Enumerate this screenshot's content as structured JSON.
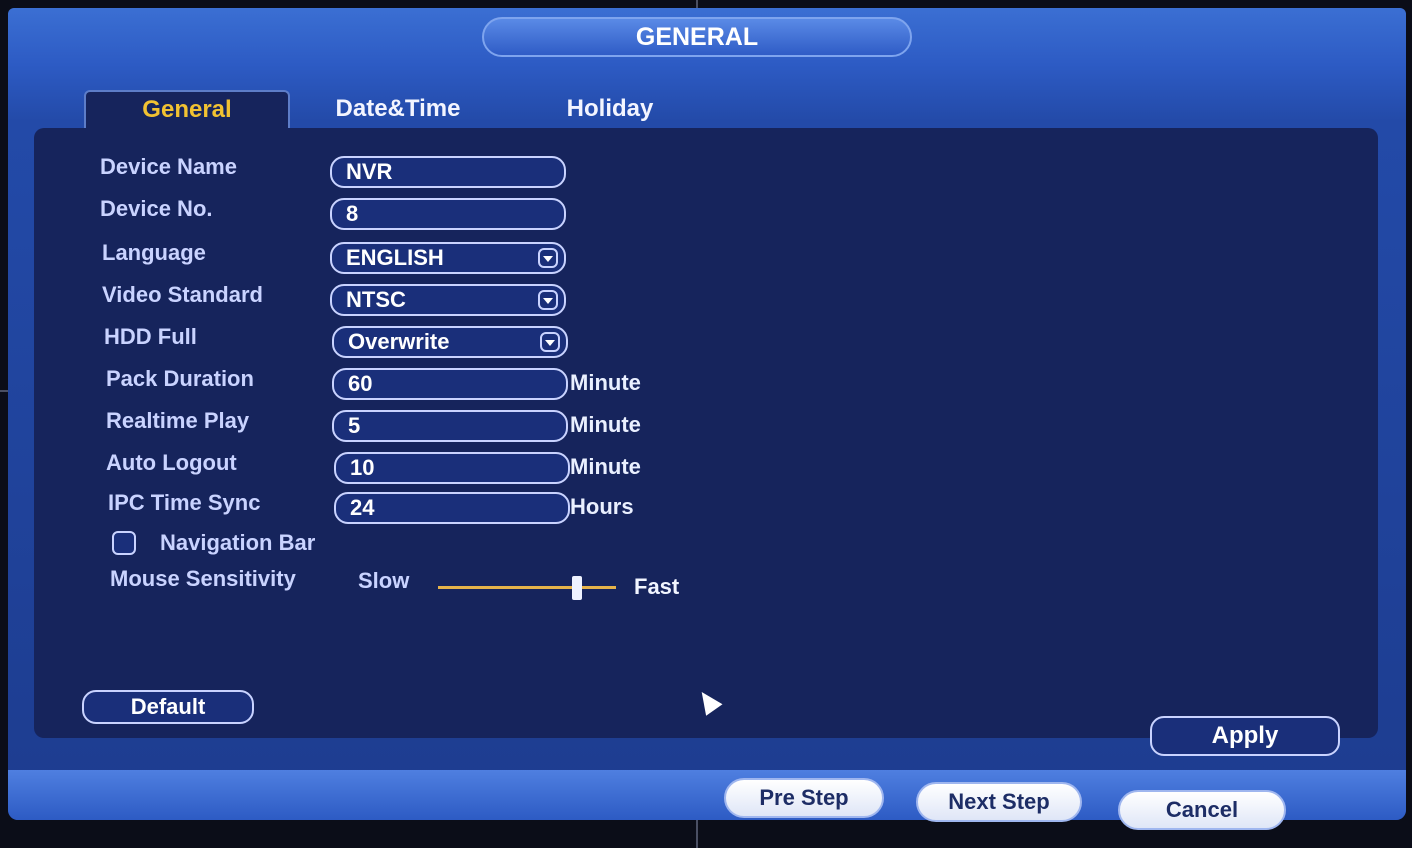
{
  "dialog": {
    "title": "GENERAL"
  },
  "tabs": [
    {
      "label": "General",
      "active": true
    },
    {
      "label": "Date&Time",
      "active": false
    },
    {
      "label": "Holiday",
      "active": false
    }
  ],
  "form": {
    "device_name": {
      "label": "Device Name",
      "value": "NVR"
    },
    "device_no": {
      "label": "Device No.",
      "value": "8"
    },
    "language": {
      "label": "Language",
      "value": "ENGLISH"
    },
    "video_standard": {
      "label": "Video Standard",
      "value": "NTSC"
    },
    "hdd_full": {
      "label": "HDD Full",
      "value": "Overwrite"
    },
    "pack_duration": {
      "label": "Pack Duration",
      "value": "60",
      "unit": "Minute"
    },
    "realtime_play": {
      "label": "Realtime Play",
      "value": "5",
      "unit": "Minute"
    },
    "auto_logout": {
      "label": "Auto Logout",
      "value": "10",
      "unit": "Minute"
    },
    "ipc_time_sync": {
      "label": "IPC Time Sync",
      "value": "24",
      "unit": "Hours"
    },
    "navigation_bar": {
      "label": "Navigation Bar",
      "checked": false
    },
    "mouse_sensitivity": {
      "label": "Mouse Sensitivity",
      "min_label": "Slow",
      "max_label": "Fast",
      "level": 0.78
    }
  },
  "buttons": {
    "default": "Default",
    "apply": "Apply",
    "pre_step": "Pre Step",
    "next_step": "Next Step",
    "cancel": "Cancel"
  },
  "colors": {
    "active_tab": "#f1c232",
    "panel_bg": "#16245c",
    "slider_track": "#e6b34a"
  }
}
